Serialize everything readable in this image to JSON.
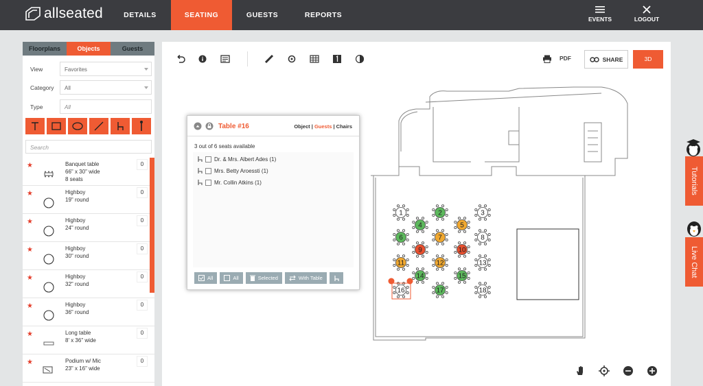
{
  "brand": {
    "logo_text": "allseated",
    "accent": "#ef5b33",
    "topbar_bg": "#3b3c40"
  },
  "nav": {
    "details": "DETAILS",
    "seating": "SEATING",
    "guests": "GUESTS",
    "reports": "REPORTS",
    "events": "EVENTS",
    "logout": "LOGOUT"
  },
  "sidebar": {
    "tabs": [
      "Floorplans",
      "Objects",
      "Guests"
    ],
    "active_tab": "Objects",
    "filters": [
      {
        "label": "View",
        "value": "Favorites"
      },
      {
        "label": "Category",
        "value": "All"
      },
      {
        "label": "Type",
        "placeholder": "All"
      }
    ],
    "tools": [
      "text-tool-icon",
      "rectangle-tool-icon",
      "ellipse-tool-icon",
      "line-tool-icon",
      "chair-tool-icon",
      "pole-tool-icon"
    ],
    "search_placeholder": "Search",
    "objects": [
      {
        "name": "Banquet table\n66\" x 30\" wide\n8 seats",
        "count": "0",
        "icon": "banquet-table-icon"
      },
      {
        "name": "Highboy\n19\" round",
        "count": "0",
        "icon": "round-table-icon"
      },
      {
        "name": "Highboy\n24\" round",
        "count": "0",
        "icon": "round-table-icon"
      },
      {
        "name": "Highboy\n30\" round",
        "count": "0",
        "icon": "round-table-icon"
      },
      {
        "name": "Highboy\n32\" round",
        "count": "0",
        "icon": "round-table-icon"
      },
      {
        "name": "Highboy\n36\" round",
        "count": "0",
        "icon": "round-table-icon"
      },
      {
        "name": "Long table\n8' x 36\" wide",
        "count": "0",
        "icon": "long-table-icon"
      },
      {
        "name": "Podium w/ Mic\n23\" x 16\" wide",
        "count": "0",
        "icon": "podium-icon"
      }
    ]
  },
  "toolbar": {
    "pdf": "PDF",
    "share": "SHARE",
    "threed": "3D"
  },
  "popup": {
    "title": "Table #16",
    "tabs": [
      "Object",
      "Guests",
      "Chairs"
    ],
    "active_tab": "Guests",
    "availability": "3 out of 6 seats available",
    "guests": [
      "Dr. & Mrs. Albert Ades (1)",
      "Mrs. Betty Aroessti (1)",
      "Mr. Collin Atkins (1)"
    ],
    "buttons": [
      "All",
      "All",
      "Selected",
      "With Table"
    ]
  },
  "tables": [
    {
      "n": "1",
      "status": "empty"
    },
    {
      "n": "2",
      "status": "full"
    },
    {
      "n": "3",
      "status": "empty"
    },
    {
      "n": "4",
      "status": "full"
    },
    {
      "n": "5",
      "status": "partial"
    },
    {
      "n": "6",
      "status": "full"
    },
    {
      "n": "7",
      "status": "partial"
    },
    {
      "n": "8",
      "status": "empty"
    },
    {
      "n": "9",
      "status": "over"
    },
    {
      "n": "10",
      "status": "over"
    },
    {
      "n": "11",
      "status": "partial"
    },
    {
      "n": "12",
      "status": "partial"
    },
    {
      "n": "13",
      "status": "empty"
    },
    {
      "n": "14",
      "status": "full"
    },
    {
      "n": "15",
      "status": "full"
    },
    {
      "n": "16",
      "status": "empty"
    },
    {
      "n": "17",
      "status": "full"
    },
    {
      "n": "18",
      "status": "empty"
    }
  ],
  "status_colors": {
    "empty": "#ffffff",
    "full": "#5cb85c",
    "partial": "#f0a830",
    "over": "#e8502f"
  },
  "side_tabs": {
    "tutorials": "Tutorials",
    "live_chat": "Live Chat"
  }
}
